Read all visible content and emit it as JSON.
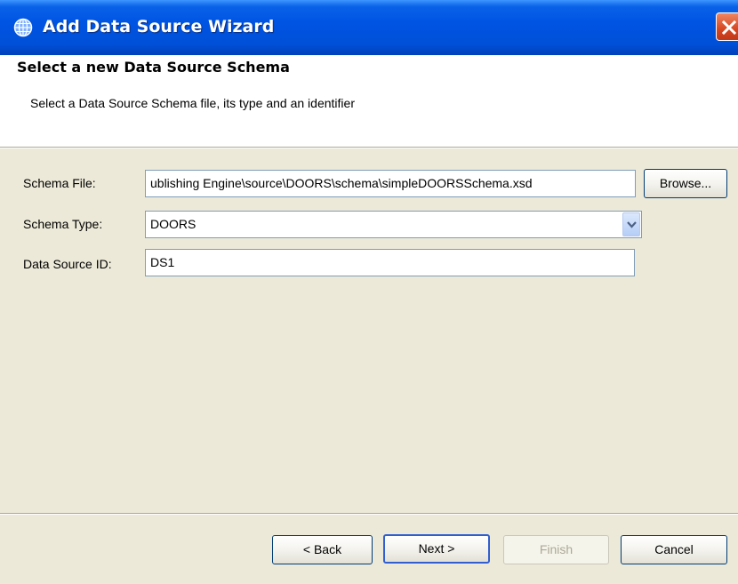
{
  "window": {
    "title": "Add Data Source Wizard"
  },
  "header": {
    "title": "Select a new Data Source Schema",
    "description": "Select a Data Source Schema file, its type and an identifier"
  },
  "form": {
    "schema_file_label": "Schema File:",
    "schema_file_value": "Publishing Engine\\source\\DOORS\\schema\\simpleDOORSSchema.xsd",
    "schema_file_display": "ublishing Engine\\source\\DOORS\\schema\\simpleDOORSSchema.xsd",
    "browse_label": "Browse...",
    "schema_type_label": "Schema Type:",
    "schema_type_value": "DOORS",
    "data_source_id_label": "Data Source ID:",
    "data_source_id_value": "DS1"
  },
  "buttons": {
    "back": "< Back",
    "next": "Next >",
    "finish": "Finish",
    "cancel": "Cancel"
  },
  "icons": {
    "app": "globe-icon",
    "close": "close-icon",
    "dropdown": "chevron-down-icon"
  },
  "colors": {
    "title_bar": "#0054e3",
    "dialog_face": "#ece9d8",
    "close_button": "#d64621",
    "default_button_border": "#315fd1",
    "combo_arrow": "#4d6185"
  }
}
